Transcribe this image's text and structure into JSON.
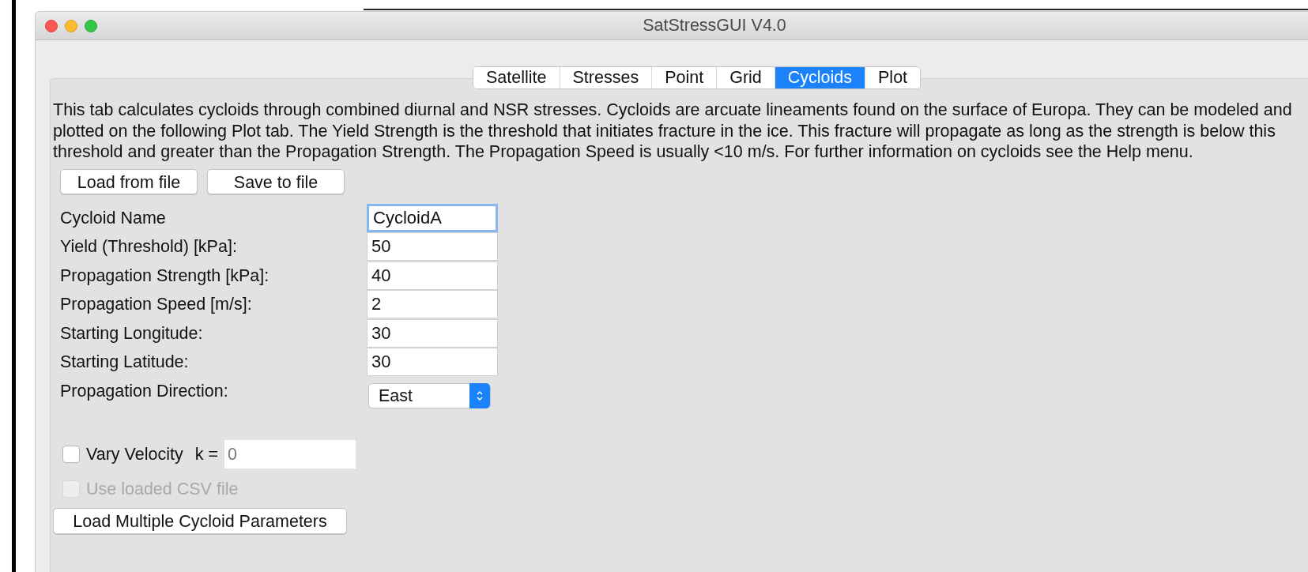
{
  "window": {
    "title": "SatStressGUI V4.0"
  },
  "tabs": [
    {
      "label": "Satellite",
      "selected": false
    },
    {
      "label": "Stresses",
      "selected": false
    },
    {
      "label": "Point",
      "selected": false
    },
    {
      "label": "Grid",
      "selected": false
    },
    {
      "label": "Cycloids",
      "selected": true
    },
    {
      "label": "Plot",
      "selected": false
    }
  ],
  "description": "This tab calculates cycloids through combined diurnal and NSR stresses. Cycloids are arcuate lineaments found on the surface of Europa. They can be modeled and plotted on the following Plot tab. The Yield Strength is the threshold that initiates fracture in the ice. This fracture will propagate as long as the strength is below this threshold and greater than the Propagation Strength. The Propagation Speed is usually <10 m/s. For further information on cycloids see the Help menu.",
  "file_buttons": [
    "Load from file",
    "Save to file"
  ],
  "fields": [
    {
      "kind": "text",
      "label": "Cycloid Name",
      "value": "CycloidA",
      "focused": true
    },
    {
      "kind": "text",
      "label": "Yield (Threshold) [kPa]:",
      "value": "50",
      "focused": false
    },
    {
      "kind": "text",
      "label": "Propagation Strength [kPa]:",
      "value": "40",
      "focused": false
    },
    {
      "kind": "text",
      "label": "Propagation Speed [m/s]:",
      "value": "2",
      "focused": false
    },
    {
      "kind": "text",
      "label": "Starting Longitude:",
      "value": "30",
      "focused": false
    },
    {
      "kind": "text",
      "label": "Starting Latitude:",
      "value": "30",
      "focused": false
    },
    {
      "kind": "select",
      "label": "Propagation Direction:",
      "value": "East",
      "focused": false
    }
  ],
  "vary_velocity": {
    "label": "Vary Velocity",
    "checked": false,
    "k_label": "k =",
    "k_value": "0"
  },
  "use_csv": {
    "label": "Use loaded CSV file",
    "checked": false,
    "disabled": true
  },
  "bottom_button": "Load Multiple Cycloid Parameters"
}
